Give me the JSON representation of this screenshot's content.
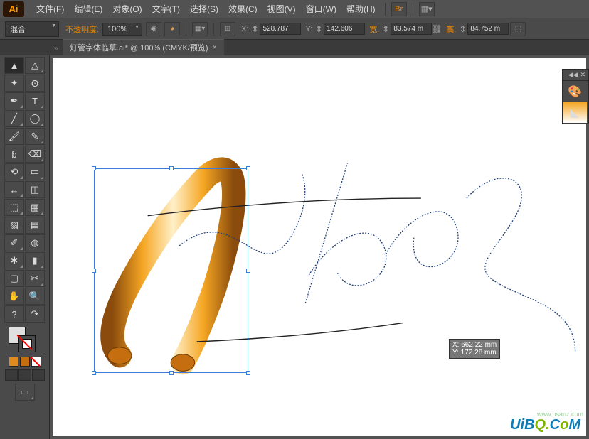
{
  "app": {
    "logo": "Ai"
  },
  "menu": {
    "file": "文件(F)",
    "edit": "编辑(E)",
    "object": "对象(O)",
    "text": "文字(T)",
    "select": "选择(S)",
    "effect": "效果(C)",
    "view": "视图(V)",
    "window": "窗口(W)",
    "help": "帮助(H)"
  },
  "options": {
    "blend": "混合",
    "opacity_label": "不透明度:",
    "opacity": "100%",
    "xlabel": "X:",
    "x": "528.787",
    "ylabel": "Y:",
    "y": "142.606",
    "wlabel": "宽:",
    "w": "83.574 m",
    "hlabel": "高:",
    "h": "84.752 m"
  },
  "tab": {
    "title": "灯管字体临摹.ai* @ 100% (CMYK/预览)"
  },
  "tooltip": {
    "line1": "X: 662.22 mm",
    "line2": "Y: 172.28 mm"
  },
  "tool_q": "?",
  "tool_icons": {
    "selection": "▲",
    "direct": "△",
    "wand": "✦",
    "lasso": "ʘ",
    "pen": "✒",
    "type": "T",
    "line": "╱",
    "ellipse": "◯",
    "brush": "🖌",
    "pencil": "✎",
    "blob": "ɓ",
    "eraser": "⌫",
    "rotate": "⟲",
    "scale": "▭",
    "width": "↔",
    "transform": "◫",
    "shapebuilder": "⬚",
    "perspective": "▦",
    "mesh": "▨",
    "gradient": "▤",
    "eyedrop": "✐",
    "blend": "◍",
    "spray": "✱",
    "graph": "▮",
    "artboard": "▢",
    "slice": "✂",
    "hand": "✋",
    "zoom": "🔍"
  },
  "watermark": {
    "t1": "UiB",
    "t2": "Q.",
    "t3": "C",
    "t4": "o",
    "t5": "M"
  },
  "site": "www.psanz.com"
}
